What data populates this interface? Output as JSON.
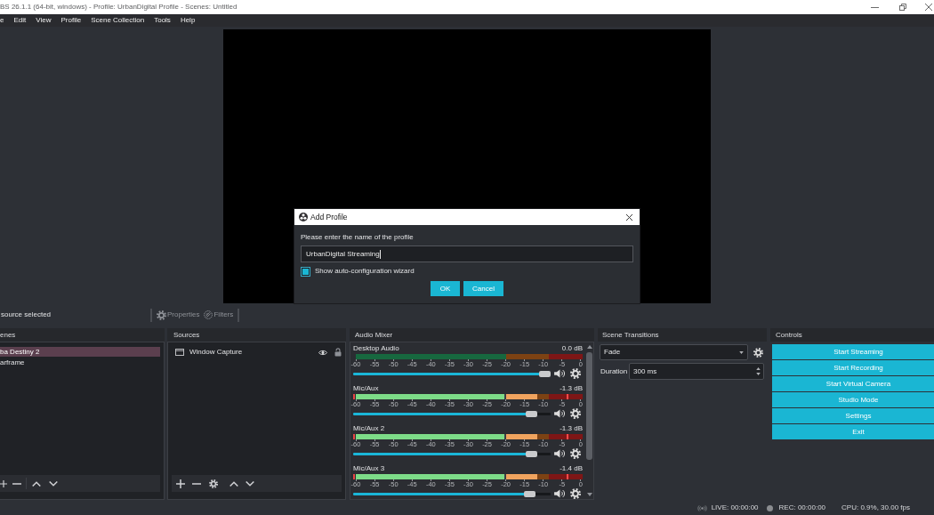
{
  "window": {
    "title": "BS 26.1.1 (64-bit, windows) - Profile: UrbanDigital Profile - Scenes: Untitled"
  },
  "menu": [
    "e",
    "Edit",
    "View",
    "Profile",
    "Scene Collection",
    "Tools",
    "Help"
  ],
  "context_bar": {
    "label": "source selected",
    "buttons": [
      {
        "kind": "properties",
        "label": "Properties",
        "disabled": true
      },
      {
        "kind": "filters",
        "label": "Filters",
        "disabled": true
      }
    ]
  },
  "scenes": {
    "title": "enes",
    "items": [
      {
        "label": "ba Destiny 2",
        "selected": true
      },
      {
        "label": "arframe",
        "selected": false
      }
    ]
  },
  "sources": {
    "title": "Sources",
    "items": [
      {
        "label": "Window Capture",
        "selected": false,
        "visible": true,
        "locked": false
      }
    ]
  },
  "audio_mixer": {
    "title": "Audio Mixer",
    "channels": [
      {
        "name": "Desktop Audio",
        "reading": "0.0 dB",
        "scale": [
          "-60",
          "-55",
          "-50",
          "-45",
          "-40",
          "-35",
          "-30",
          "-25",
          "-20",
          "-15",
          "-10",
          "-5",
          "0"
        ],
        "volume": {
          "level": 1
        },
        "muted": false
      },
      {
        "name": "Mic/Aux",
        "reading": "-1.3 dB",
        "meter": {
          "level": 0.8
        },
        "peak": {
          "level": 0.93
        },
        "scale": [
          "-60",
          "-55",
          "-50",
          "-45",
          "-40",
          "-35",
          "-30",
          "-25",
          "-20",
          "-15",
          "-10",
          "-5",
          "0"
        ],
        "volume": {
          "level": 0.93
        },
        "muted": false
      },
      {
        "name": "Mic/Aux 2",
        "reading": "-1.3 dB",
        "meter": {
          "level": 0.8
        },
        "peak": {
          "level": 0.93
        },
        "scale": [
          "-60",
          "-55",
          "-50",
          "-45",
          "-40",
          "-35",
          "-30",
          "-25",
          "-20",
          "-15",
          "-10",
          "-5",
          "0"
        ],
        "volume": {
          "level": 0.93
        },
        "muted": false
      },
      {
        "name": "Mic/Aux 3",
        "reading": "-1.4 dB",
        "meter": {
          "level": 0.8
        },
        "peak": {
          "level": 0.93
        },
        "scale": [
          "-60",
          "-55",
          "-50",
          "-45",
          "-40",
          "-35",
          "-30",
          "-25",
          "-20",
          "-15",
          "-10",
          "-5",
          "0"
        ],
        "volume": {
          "level": 0.92
        },
        "muted": false
      }
    ]
  },
  "scene_transitions": {
    "title": "Scene Transitions",
    "transition": "Fade",
    "duration_label": "Duration",
    "duration": "300 ms"
  },
  "controls": {
    "title": "Controls",
    "buttons": [
      "Start Streaming",
      "Start Recording",
      "Start Virtual Camera",
      "Studio Mode",
      "Settings",
      "Exit"
    ]
  },
  "status_bar": {
    "live": "LIVE: 00:00:00",
    "rec": "REC: 00:00:00",
    "cpu": "CPU: 0.9%, 30.00 fps"
  },
  "dialog": {
    "title": "Add Profile",
    "prompt": "Please enter the name of the profile",
    "value": "UrbanDigital Streaming",
    "checkbox": {
      "label": "Show auto-configuration wizard",
      "checked": true
    },
    "buttons": [
      "OK",
      "Cancel"
    ]
  }
}
